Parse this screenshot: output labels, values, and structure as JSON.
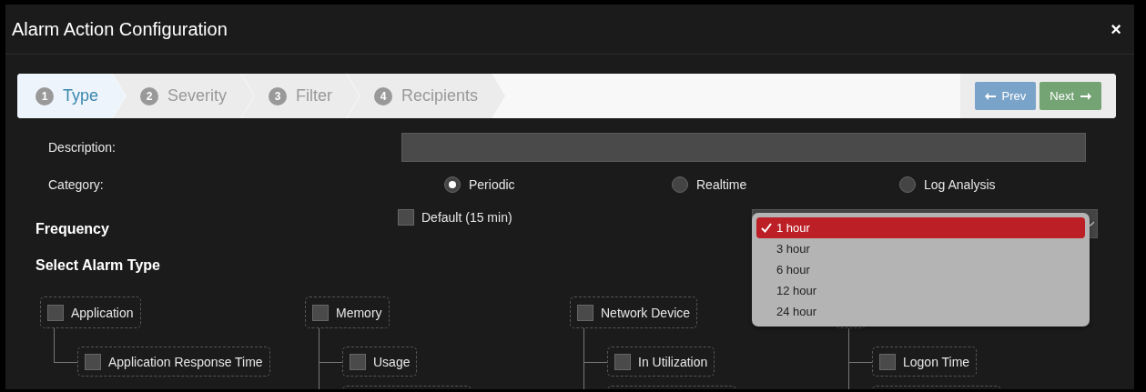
{
  "window": {
    "title": "Alarm Action Configuration",
    "close": "×"
  },
  "wizard": {
    "steps": [
      {
        "number": "1",
        "label": "Type",
        "selected": true
      },
      {
        "number": "2",
        "label": "Severity",
        "selected": false
      },
      {
        "number": "3",
        "label": "Filter",
        "selected": false
      },
      {
        "number": "4",
        "label": "Recipients",
        "selected": false
      }
    ],
    "prev": "Prev",
    "next": "Next"
  },
  "description": {
    "label": "Description:"
  },
  "category": {
    "label": "Category:",
    "options": [
      {
        "label": "Periodic",
        "selected": true
      },
      {
        "label": "Realtime",
        "selected": false
      },
      {
        "label": "Log Analysis",
        "selected": false
      }
    ]
  },
  "frequency": {
    "label": "Frequency",
    "default": {
      "label": "Default (15 min)",
      "checked": false
    },
    "dropdown": [
      {
        "label": "1 hour",
        "selected": true
      },
      {
        "label": "3 hour",
        "selected": false
      },
      {
        "label": "6 hour",
        "selected": false
      },
      {
        "label": "12 hour",
        "selected": false
      },
      {
        "label": "24 hour",
        "selected": false
      }
    ]
  },
  "alarm_types": {
    "title": "Select Alarm Type",
    "groups": [
      {
        "label": "Application",
        "checked": false,
        "continues": false,
        "children": [
          {
            "label": "Application Response Time",
            "checked": false
          }
        ]
      },
      {
        "label": "Memory",
        "checked": false,
        "continues": true,
        "children": [
          {
            "label": "Usage",
            "checked": false
          }
        ]
      },
      {
        "label": "Network Device",
        "checked": false,
        "continues": true,
        "children": [
          {
            "label": "In Utilization",
            "checked": false
          }
        ]
      },
      {
        "continues": true,
        "children": [
          {
            "label": "Logon Time",
            "checked": false
          }
        ]
      }
    ]
  }
}
